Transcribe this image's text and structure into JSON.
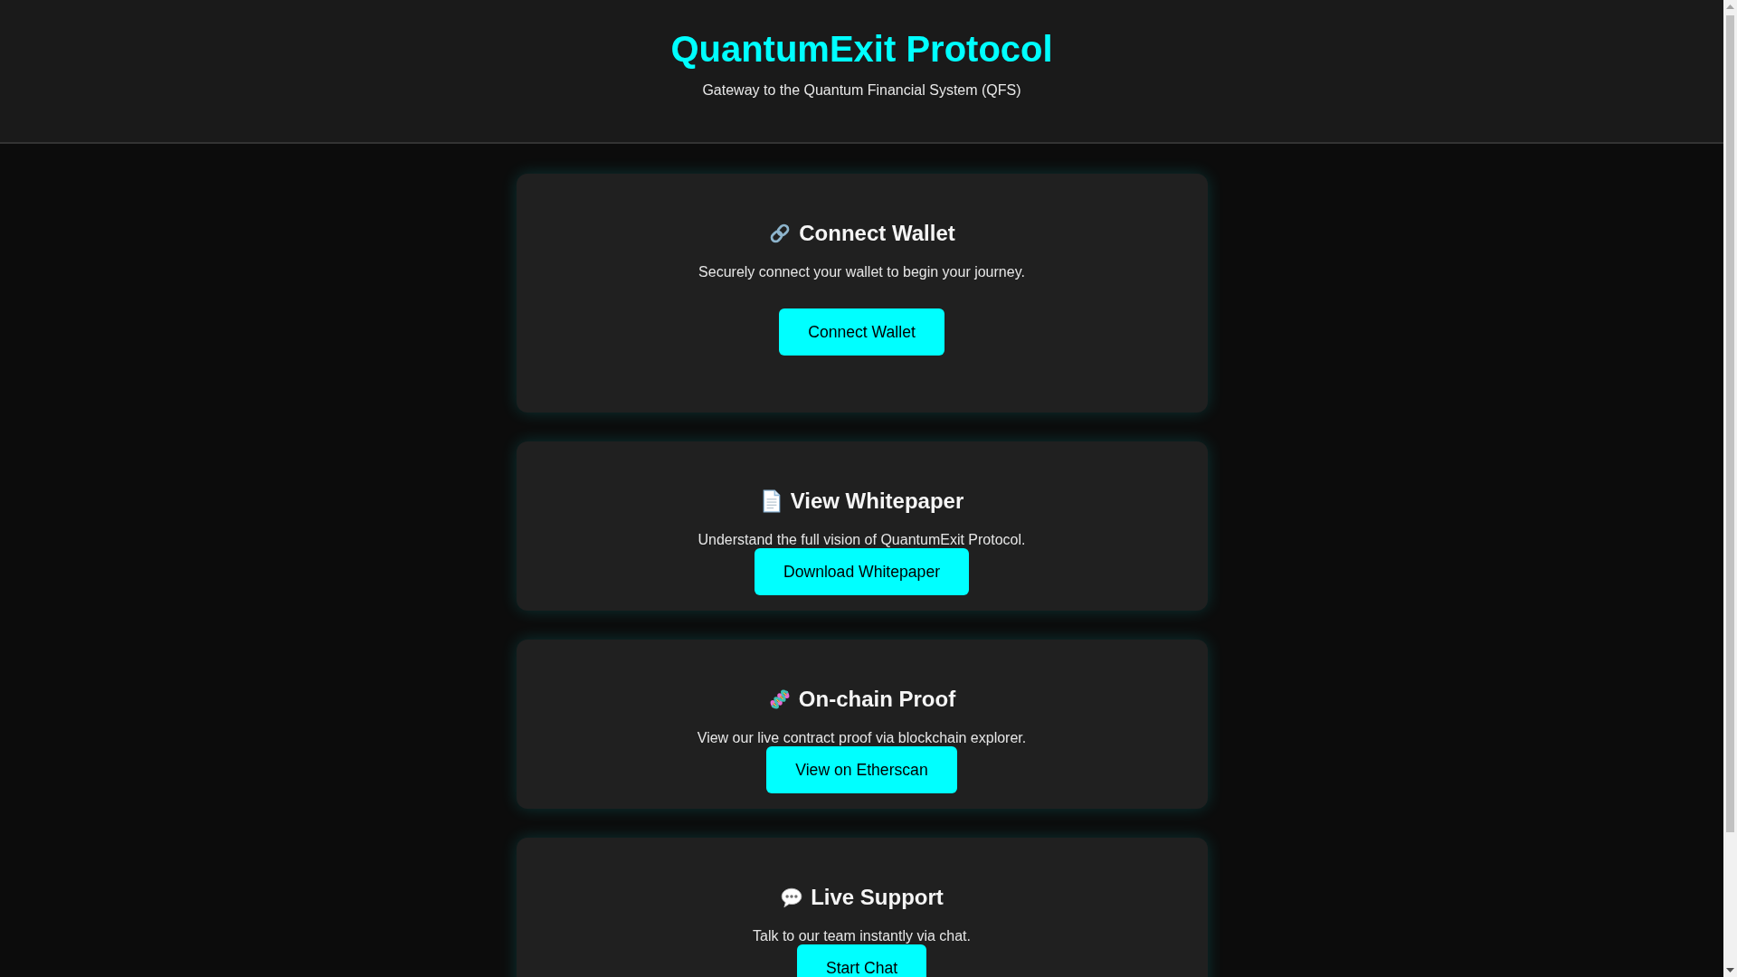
{
  "header": {
    "title": "QuantumExit Protocol",
    "subtitle": "Gateway to the Quantum Financial System (QFS)"
  },
  "cards": [
    {
      "kind": "action",
      "title": "Connect Wallet",
      "description": "Securely connect your wallet to begin your journey.",
      "button": "Connect Wallet"
    },
    {
      "kind": "link",
      "title": "View Whitepaper",
      "description": "Understand the full vision of QuantumExit Protocol.",
      "button": "Download Whitepaper"
    },
    {
      "kind": "link",
      "title": "On-chain Proof",
      "description": "View our live contract proof via blockchain explorer.",
      "button": "View on Etherscan"
    },
    {
      "kind": "link",
      "title": "Live Support",
      "description": "Talk to our team instantly via chat.",
      "button": "Start Chat"
    }
  ]
}
